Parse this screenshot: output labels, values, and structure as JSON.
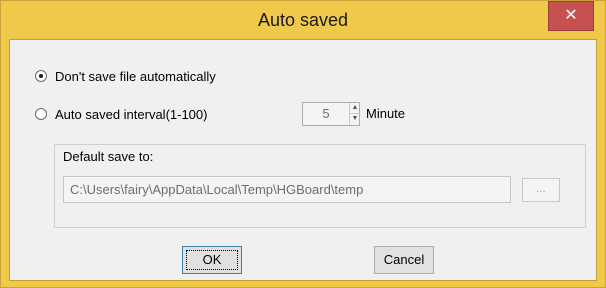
{
  "window": {
    "title": "Auto saved",
    "close_glyph": "✕"
  },
  "options": {
    "no_autosave_label": "Don't save file automatically",
    "interval_label": "Auto saved interval(1-100)",
    "selected": "no_autosave"
  },
  "interval": {
    "value": "5",
    "unit": "Minute",
    "up_glyph": "▲",
    "down_glyph": "▼"
  },
  "save_location": {
    "group_label": "Default save to:",
    "path": "C:\\Users\\fairy\\AppData\\Local\\Temp\\HGBoard\\temp",
    "browse_label": "..."
  },
  "buttons": {
    "ok_label": "OK",
    "cancel_label": "Cancel"
  },
  "colors": {
    "titlebar": "#f0c94b",
    "close_button": "#c75050",
    "client": "#f0f0f0"
  }
}
